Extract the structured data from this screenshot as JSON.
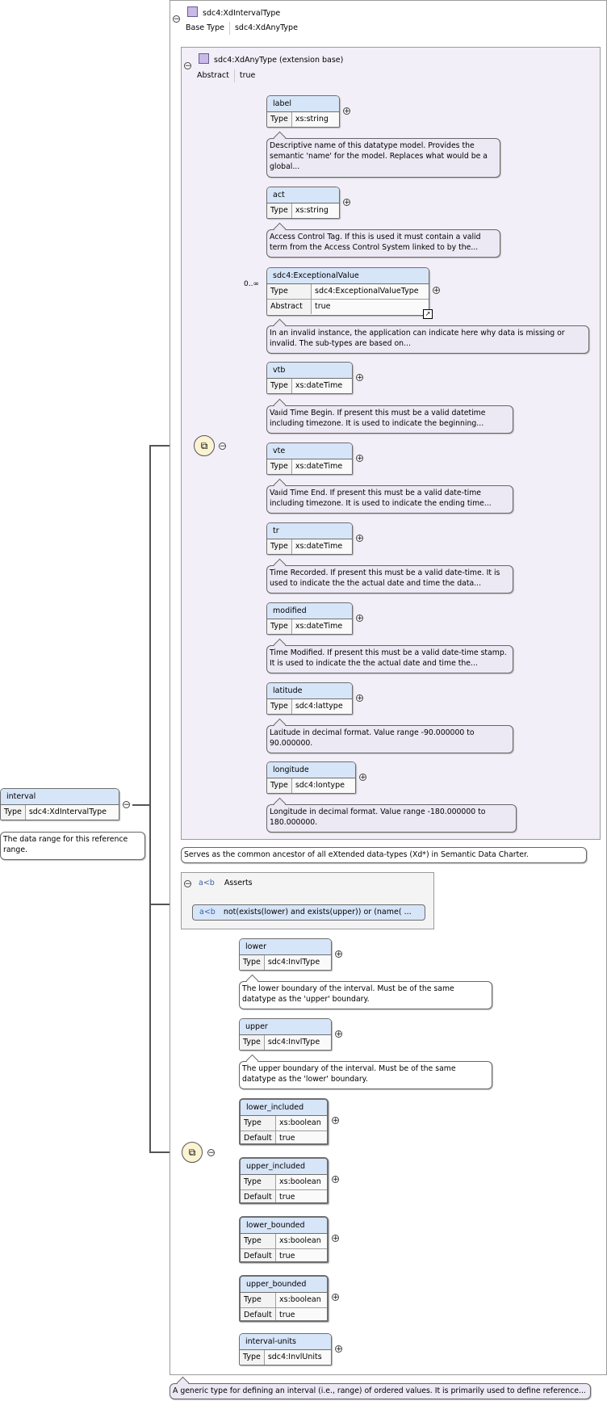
{
  "root_type": {
    "name": "sdc4:XdIntervalType",
    "base_label": "Base Type",
    "base_value": "sdc4:XdAnyType"
  },
  "extension": {
    "name": "sdc4:XdAnyType (extension base)",
    "abstract_label": "Abstract",
    "abstract_value": "true"
  },
  "interval": {
    "name": "interval",
    "type_label": "Type",
    "type_value": "sdc4:XdIntervalType",
    "doc": "The data range for this reference range."
  },
  "elements": [
    {
      "name": "label",
      "type": "xs:string",
      "doc": "Descriptive name of this datatype model. Provides the semantic 'name' for the model. Replaces what would be a global..."
    },
    {
      "name": "act",
      "type": "xs:string",
      "doc": "Access Control Tag. If this is used it must contain a valid term from the Access Control System linked to by the..."
    },
    {
      "name": "sdc4:ExceptionalValue",
      "type": "sdc4:ExceptionalValueType",
      "abstract": "true",
      "occurs": "0..∞",
      "doc": "In an invalid instance, the application can indicate here why data is missing or invalid. The sub-types are based on..."
    },
    {
      "name": "vtb",
      "type": "xs:dateTime",
      "doc": "Valid Time Begin. If present this must be a valid datetime including timezone. It is used to indicate the beginning..."
    },
    {
      "name": "vte",
      "type": "xs:dateTime",
      "doc": "Valid Time End. If present this must be a valid date-time including timezone. It is used to indicate the ending time..."
    },
    {
      "name": "tr",
      "type": "xs:dateTime",
      "doc": "Time Recorded. If present this must be a valid date-time. It is used to indicate the the actual date and time the data..."
    },
    {
      "name": "modified",
      "type": "xs:dateTime",
      "doc": "Time Modified. If present this must be a valid date-time stamp. It is used to indicate the the actual date and time the..."
    },
    {
      "name": "latitude",
      "type": "sdc4:lattype",
      "doc": "Latitude in decimal format. Value range -90.000000 to 90.000000."
    },
    {
      "name": "longitude",
      "type": "sdc4:lontype",
      "doc": "Longitude in decimal format. Value range -180.000000 to 180.000000."
    }
  ],
  "extension_doc": "Serves as the common ancestor of all eXtended data-types (Xd*) in Semantic Data Charter.",
  "asserts": {
    "title": "Asserts",
    "icon": "a<b",
    "expression": "not(exists(lower) and exists(upper)) or (name( ..."
  },
  "local": [
    {
      "name": "lower",
      "type": "sdc4:InvlType",
      "doc": "The lower boundary of the interval. Must be of the same datatype as the 'upper' boundary."
    },
    {
      "name": "upper",
      "type": "sdc4:InvlType",
      "doc": "The upper boundary of the interval. Must be of the same datatype as the 'lower' boundary."
    },
    {
      "name": "lower_included",
      "type": "xs:boolean",
      "default": "true"
    },
    {
      "name": "upper_included",
      "type": "xs:boolean",
      "default": "true"
    },
    {
      "name": "lower_bounded",
      "type": "xs:boolean",
      "default": "true"
    },
    {
      "name": "upper_bounded",
      "type": "xs:boolean",
      "default": "true"
    },
    {
      "name": "interval-units",
      "type": "sdc4:InvlUnits"
    }
  ],
  "labels": {
    "type": "Type",
    "abstract": "Abstract",
    "default": "Default"
  },
  "root_doc": "A generic type for defining an interval (i.e., range) of ordered values. It is primarily used to define reference...",
  "colors": {
    "element_header": "#d7e5f8",
    "doc_bg": "#ece9f4",
    "extension_bg": "#f3eff8"
  },
  "icons": {
    "collapse": "minus-circle-icon",
    "expand": "plus-circle-icon",
    "sequence": "sequence-compositor-icon",
    "complex_type": "complex-type-icon",
    "link": "link-arrow-icon"
  }
}
